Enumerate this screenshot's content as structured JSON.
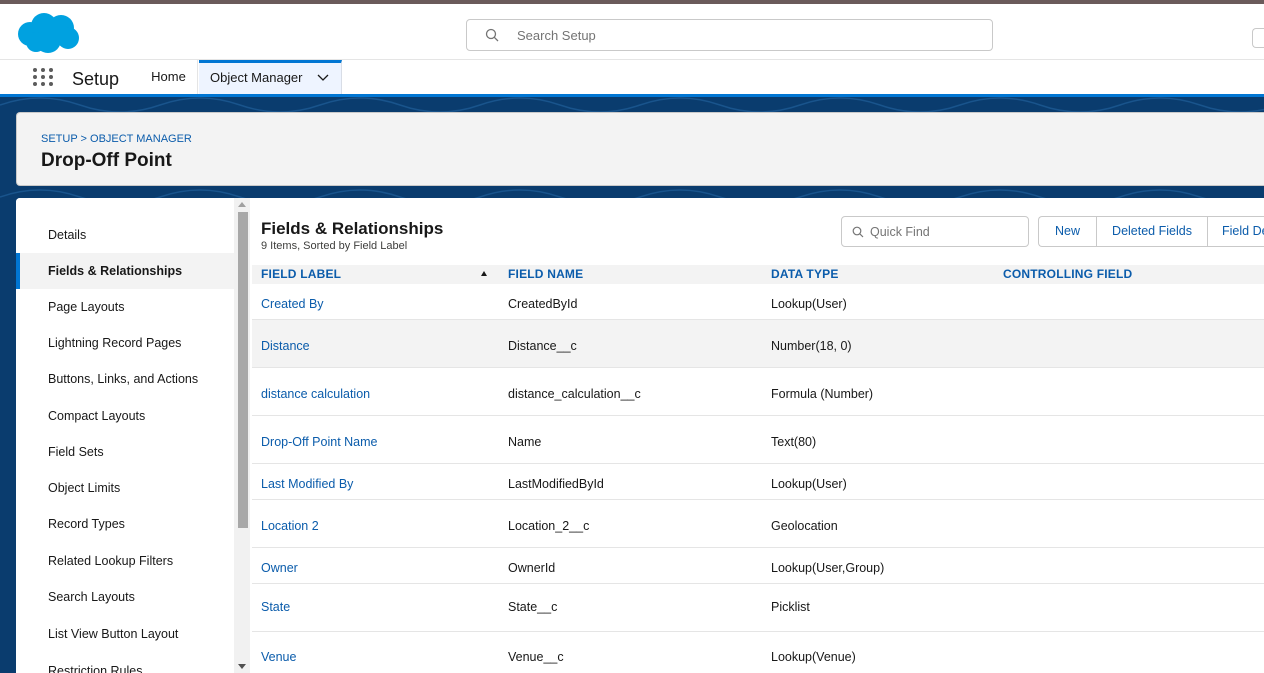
{
  "header": {
    "search_placeholder": "Search Setup"
  },
  "nav": {
    "app_name": "Setup",
    "home": "Home",
    "object_manager": "Object Manager"
  },
  "page": {
    "breadcrumb": "SETUP > OBJECT MANAGER",
    "title": "Drop-Off Point"
  },
  "sidebar": {
    "items": [
      {
        "label": "Details",
        "active": false
      },
      {
        "label": "Fields & Relationships",
        "active": true
      },
      {
        "label": "Page Layouts",
        "active": false
      },
      {
        "label": "Lightning Record Pages",
        "active": false
      },
      {
        "label": "Buttons, Links, and Actions",
        "active": false
      },
      {
        "label": "Compact Layouts",
        "active": false
      },
      {
        "label": "Field Sets",
        "active": false
      },
      {
        "label": "Object Limits",
        "active": false
      },
      {
        "label": "Record Types",
        "active": false
      },
      {
        "label": "Related Lookup Filters",
        "active": false
      },
      {
        "label": "Search Layouts",
        "active": false
      },
      {
        "label": "List View Button Layout",
        "active": false
      },
      {
        "label": "Restriction Rules",
        "active": false
      }
    ]
  },
  "section": {
    "title": "Fields & Relationships",
    "subtitle": "9 Items, Sorted by Field Label",
    "quick_find_placeholder": "Quick Find",
    "buttons": [
      "New",
      "Deleted Fields",
      "Field Dependencies"
    ]
  },
  "table": {
    "columns": [
      "FIELD LABEL",
      "FIELD NAME",
      "DATA TYPE",
      "CONTROLLING FIELD"
    ],
    "rows": [
      {
        "label": "Created By",
        "name": "CreatedById",
        "type": "Lookup(User)",
        "controlling": ""
      },
      {
        "label": "Distance",
        "name": "Distance__c",
        "type": "Number(18, 0)",
        "controlling": ""
      },
      {
        "label": "distance calculation",
        "name": "distance_calculation__c",
        "type": "Formula (Number)",
        "controlling": ""
      },
      {
        "label": "Drop-Off Point Name",
        "name": "Name",
        "type": "Text(80)",
        "controlling": ""
      },
      {
        "label": "Last Modified By",
        "name": "LastModifiedById",
        "type": "Lookup(User)",
        "controlling": ""
      },
      {
        "label": "Location 2",
        "name": "Location_2__c",
        "type": "Geolocation",
        "controlling": ""
      },
      {
        "label": "Owner",
        "name": "OwnerId",
        "type": "Lookup(User,Group)",
        "controlling": ""
      },
      {
        "label": "State",
        "name": "State__c",
        "type": "Picklist",
        "controlling": ""
      },
      {
        "label": "Venue",
        "name": "Venue__c",
        "type": "Lookup(Venue)",
        "controlling": ""
      }
    ]
  },
  "colors": {
    "brand_blue": "#0176d3",
    "link_blue": "#0b5cab",
    "cloud_blue": "#00a1e0",
    "banner_navy": "#0a3c6e"
  }
}
